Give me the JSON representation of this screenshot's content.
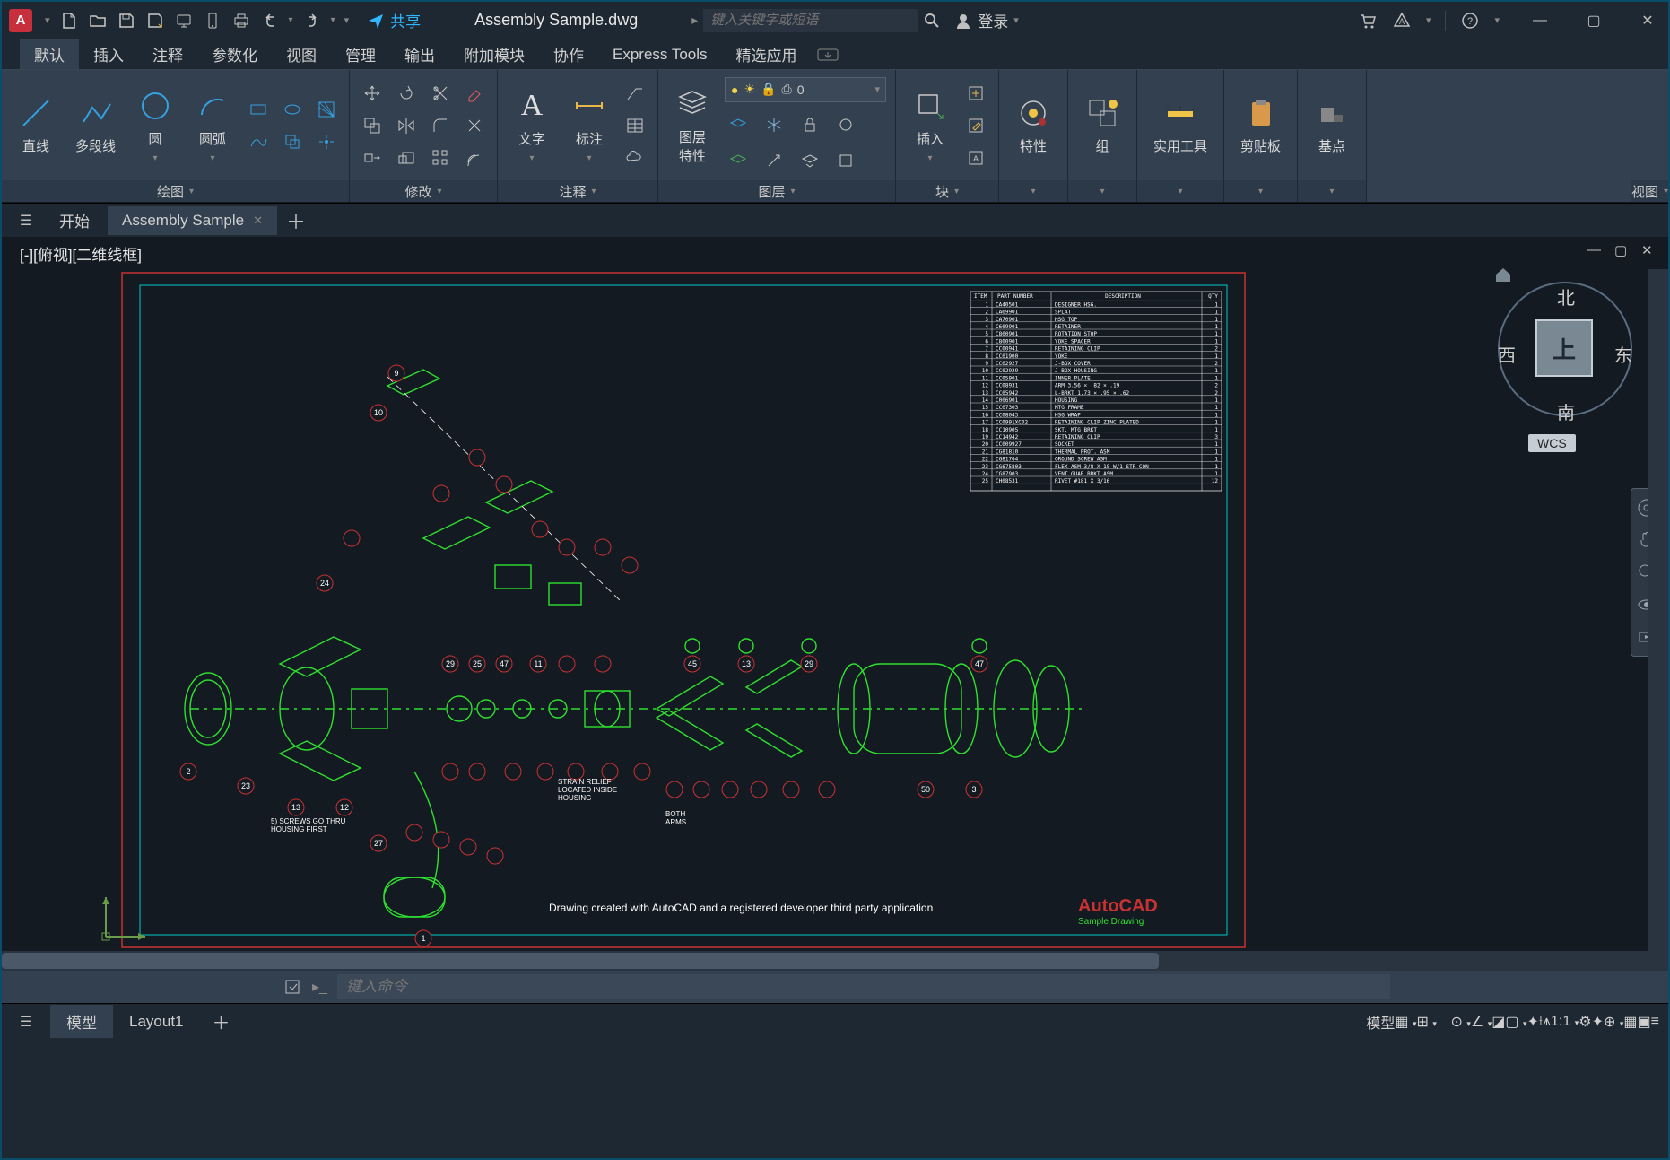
{
  "titlebar": {
    "share": "共享",
    "document": "Assembly Sample.dwg",
    "search_placeholder": "键入关键字或短语",
    "login": "登录"
  },
  "ribbon_tabs": [
    "默认",
    "插入",
    "注释",
    "参数化",
    "视图",
    "管理",
    "输出",
    "附加模块",
    "协作",
    "Express Tools",
    "精选应用"
  ],
  "active_ribbon_tab": 0,
  "panels": {
    "draw": {
      "title": "绘图",
      "line": "直线",
      "polyline": "多段线",
      "circle": "圆",
      "arc": "圆弧"
    },
    "modify": {
      "title": "修改"
    },
    "annotate": {
      "title": "注释",
      "text": "文字",
      "dim": "标注"
    },
    "layers": {
      "title": "图层",
      "props": "图层\n特性",
      "current": "0"
    },
    "block": {
      "title": "块",
      "insert": "插入"
    },
    "properties": {
      "title": "特性"
    },
    "groups": {
      "title": "组"
    },
    "utilities": {
      "title": "实用工具"
    },
    "clipboard": {
      "title": "剪贴板"
    },
    "base": {
      "title": "基点"
    },
    "view": {
      "title": "视图"
    }
  },
  "doc_tabs": {
    "start": "开始",
    "current": "Assembly Sample"
  },
  "viewport_label": "[-][俯视][二维线框]",
  "viewcube": {
    "face": "上",
    "n": "北",
    "s": "南",
    "e": "东",
    "w": "西",
    "wcs": "WCS"
  },
  "drawing": {
    "credit": "Drawing created with AutoCAD and a registered developer third party application",
    "brand": "AutoCAD",
    "brand2": "Sample Drawing",
    "note_screws": "5) SCREWS GO THRU\nHOUSING FIRST",
    "note_strain": "STRAIN RELIEF\nLOCATED INSIDE\nHOUSING",
    "note_arms": "BOTH\nARMS",
    "bom_header": [
      "ITEM",
      "PART NUMBER",
      "DESCRIPTION",
      "QTY"
    ],
    "bom_rows": [
      [
        "1",
        "CA40501",
        "DESIGNER HSG.",
        "1"
      ],
      [
        "2",
        "CA69901",
        "SPLAT",
        "1"
      ],
      [
        "3",
        "CA70901",
        "HSG TOP",
        "1"
      ],
      [
        "4",
        "C609901",
        "RETAINER",
        "1"
      ],
      [
        "5",
        "C800901",
        "ROTATION STOP",
        "1"
      ],
      [
        "6",
        "C800901",
        "YOKE SPACER",
        "1"
      ],
      [
        "7",
        "CC00941",
        "RETAINING CLIP",
        "2"
      ],
      [
        "8",
        "CC01900",
        "YOKE",
        "1"
      ],
      [
        "9",
        "CC02927",
        "J-BOX COVER",
        "2"
      ],
      [
        "10",
        "CC02929",
        "J-BOX HOUSING",
        "1"
      ],
      [
        "11",
        "CC05901",
        "INNER PLATE",
        "1"
      ],
      [
        "12",
        "CC08931",
        "ARM 3.56 × .82 × .19",
        "2"
      ],
      [
        "13",
        "CC05942",
        "L-BRKT 1.73 × .95 × .62",
        "2"
      ],
      [
        "14",
        "C006901",
        "HOUSING",
        "1"
      ],
      [
        "15",
        "CC07303",
        "MTG FRAME",
        "1"
      ],
      [
        "16",
        "CC08043",
        "HSG WRAP",
        "1"
      ],
      [
        "17",
        "CC0991XC02",
        "RETAINING CLIP ZINC PLATED",
        "1"
      ],
      [
        "18",
        "CC10905",
        "SKT. MTG BRKT",
        "1"
      ],
      [
        "19",
        "CC14942",
        "RETAINING CLIP",
        "3"
      ],
      [
        "20",
        "CC009927",
        "SOCKET",
        "1"
      ],
      [
        "21",
        "CG81810",
        "THERMAL PROT. ASM",
        "1"
      ],
      [
        "22",
        "CG81764",
        "GROUND SCREW ASM",
        "1"
      ],
      [
        "23",
        "CG675803",
        "FLEX ASM 3/8 X 18 W/1 STR CON",
        "1"
      ],
      [
        "24",
        "CG87903",
        "VENT GUAR BRKT ASM",
        "1"
      ],
      [
        "25",
        "CH08531",
        "RIVET #181 X 3/16",
        "12"
      ]
    ]
  },
  "command_placeholder": "键入命令",
  "layout_tabs": {
    "model": "模型",
    "layout1": "Layout1"
  },
  "status": {
    "model": "模型",
    "scale": "1:1"
  }
}
